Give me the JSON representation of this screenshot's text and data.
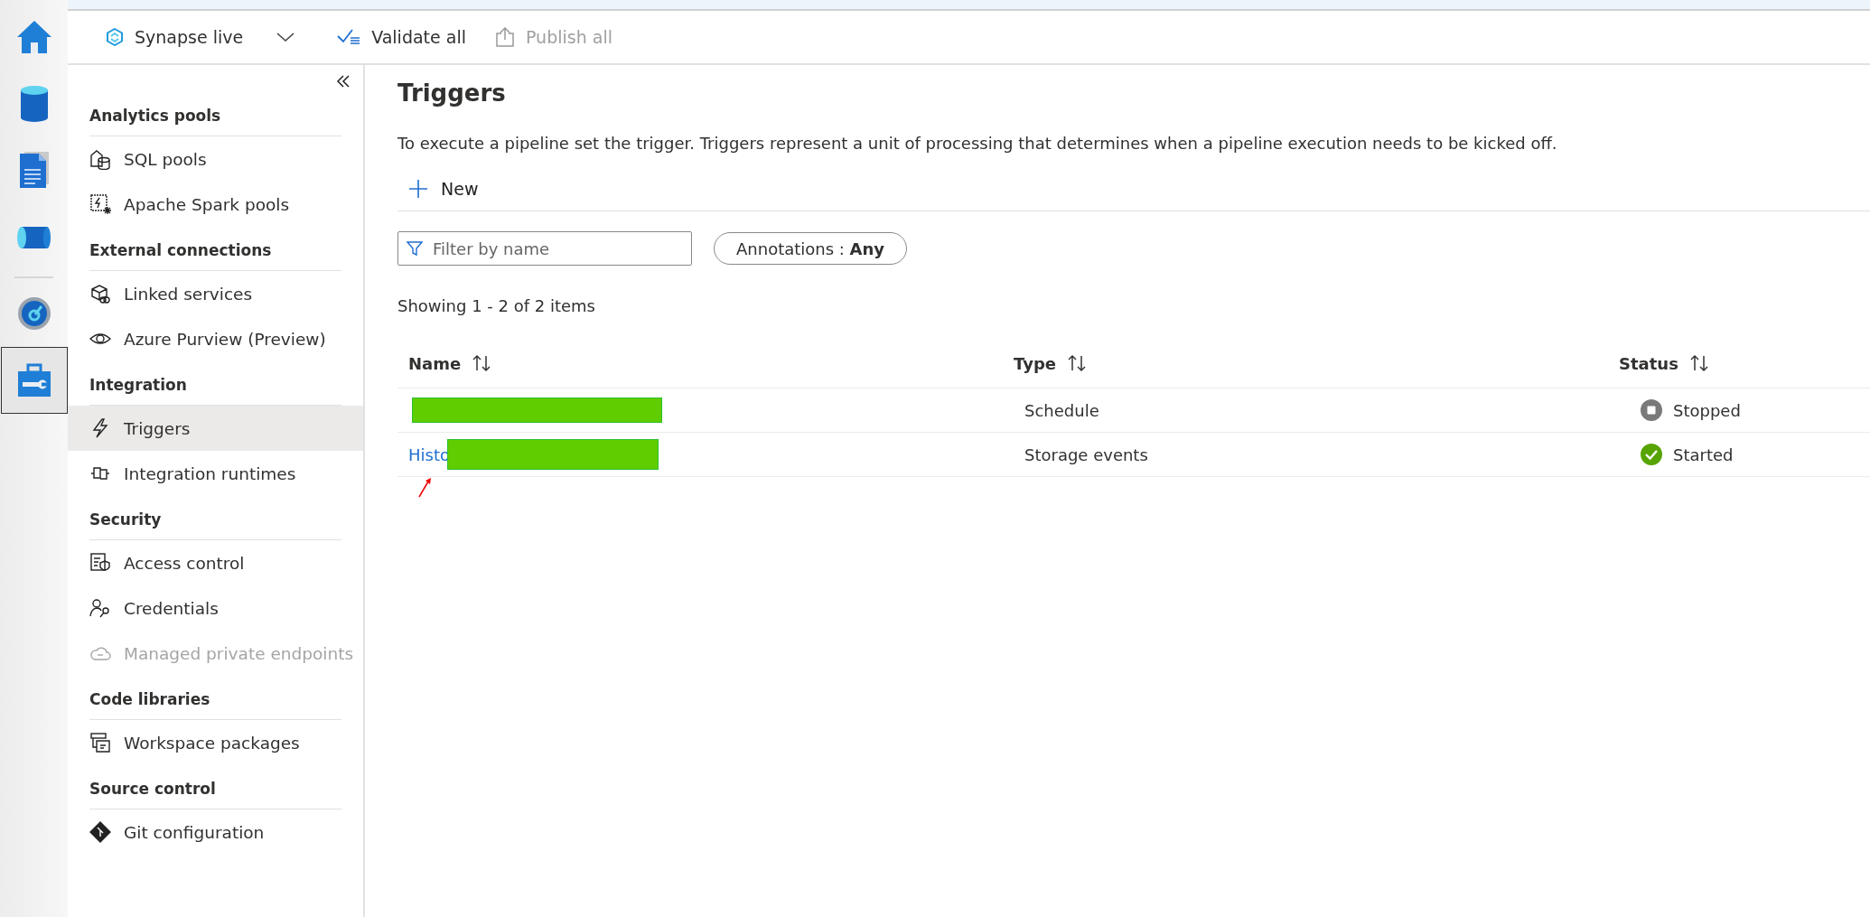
{
  "rail": [
    {
      "kind": "home",
      "selected": false
    },
    {
      "kind": "data",
      "selected": false
    },
    {
      "kind": "develop",
      "selected": false
    },
    {
      "kind": "integrate",
      "selected": false
    },
    {
      "kind": "monitor",
      "selected": false
    },
    {
      "kind": "manage",
      "selected": true
    }
  ],
  "toolbar": {
    "workspace": "Synapse live",
    "validate": "Validate all",
    "publish": {
      "label": "Publish all",
      "disabled": true
    }
  },
  "nav": [
    {
      "heading": "Analytics pools",
      "items": [
        {
          "kind": "sql",
          "label": "SQL pools",
          "selected": false,
          "disabled": false
        },
        {
          "kind": "spark",
          "label": "Apache Spark pools",
          "selected": false,
          "disabled": false
        }
      ]
    },
    {
      "heading": "External connections",
      "items": [
        {
          "kind": "linked",
          "label": "Linked services",
          "selected": false,
          "disabled": false
        },
        {
          "kind": "eye",
          "label": "Azure Purview (Preview)",
          "selected": false,
          "disabled": false
        }
      ]
    },
    {
      "heading": "Integration",
      "items": [
        {
          "kind": "bolt",
          "label": "Triggers",
          "selected": true,
          "disabled": false
        },
        {
          "kind": "runtime",
          "label": "Integration runtimes",
          "selected": false,
          "disabled": false
        }
      ]
    },
    {
      "heading": "Security",
      "items": [
        {
          "kind": "access",
          "label": "Access control",
          "selected": false,
          "disabled": false
        },
        {
          "kind": "cred",
          "label": "Credentials",
          "selected": false,
          "disabled": false
        },
        {
          "kind": "cloud",
          "label": "Managed private endpoints",
          "selected": false,
          "disabled": true
        }
      ]
    },
    {
      "heading": "Code libraries",
      "items": [
        {
          "kind": "packages",
          "label": "Workspace packages",
          "selected": false,
          "disabled": false
        }
      ]
    },
    {
      "heading": "Source control",
      "items": [
        {
          "kind": "git",
          "label": "Git configuration",
          "selected": false,
          "disabled": false
        }
      ]
    }
  ],
  "page": {
    "title": "Triggers",
    "description": "To execute a pipeline set the trigger. Triggers represent a unit of processing that determines when a pipeline execution needs to be kicked off.",
    "new_button": "New",
    "filter": {
      "placeholder": "Filter by name"
    },
    "annotations": {
      "label": "Annotations :",
      "value": "Any"
    },
    "count": "Showing 1 - 2 of 2 items"
  },
  "table": {
    "columns": [
      "Name",
      "Type",
      "Status"
    ],
    "rows": [
      {
        "type": "Schedule",
        "status": "Stopped",
        "kind": "stopped"
      },
      {
        "name": "Histo",
        "type": "Storage events",
        "status": "Started",
        "kind": "started"
      }
    ]
  }
}
